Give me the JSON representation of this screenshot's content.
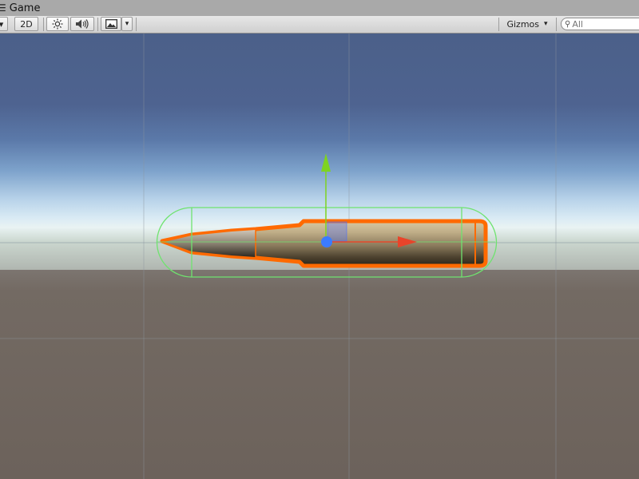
{
  "tab": {
    "label": "Game",
    "icon": "game-tab-icon"
  },
  "toolbar": {
    "dropdown_arrow": "▾",
    "mode_2d_label": "2D",
    "lighting_icon": "sun-icon",
    "audio_icon": "speaker-icon",
    "effects_icon": "image-icon",
    "gizmos_label": "Gizmos",
    "gizmos_arrow": "▾",
    "search_placeholder": "All"
  },
  "scene": {
    "object": "bullet",
    "selected": true,
    "colors": {
      "selection_outline": "#ff6a00",
      "collider": "#6fe36f",
      "y_axis": "#7ed321",
      "x_axis": "#e8442a",
      "pivot": "#3b7bff"
    }
  }
}
